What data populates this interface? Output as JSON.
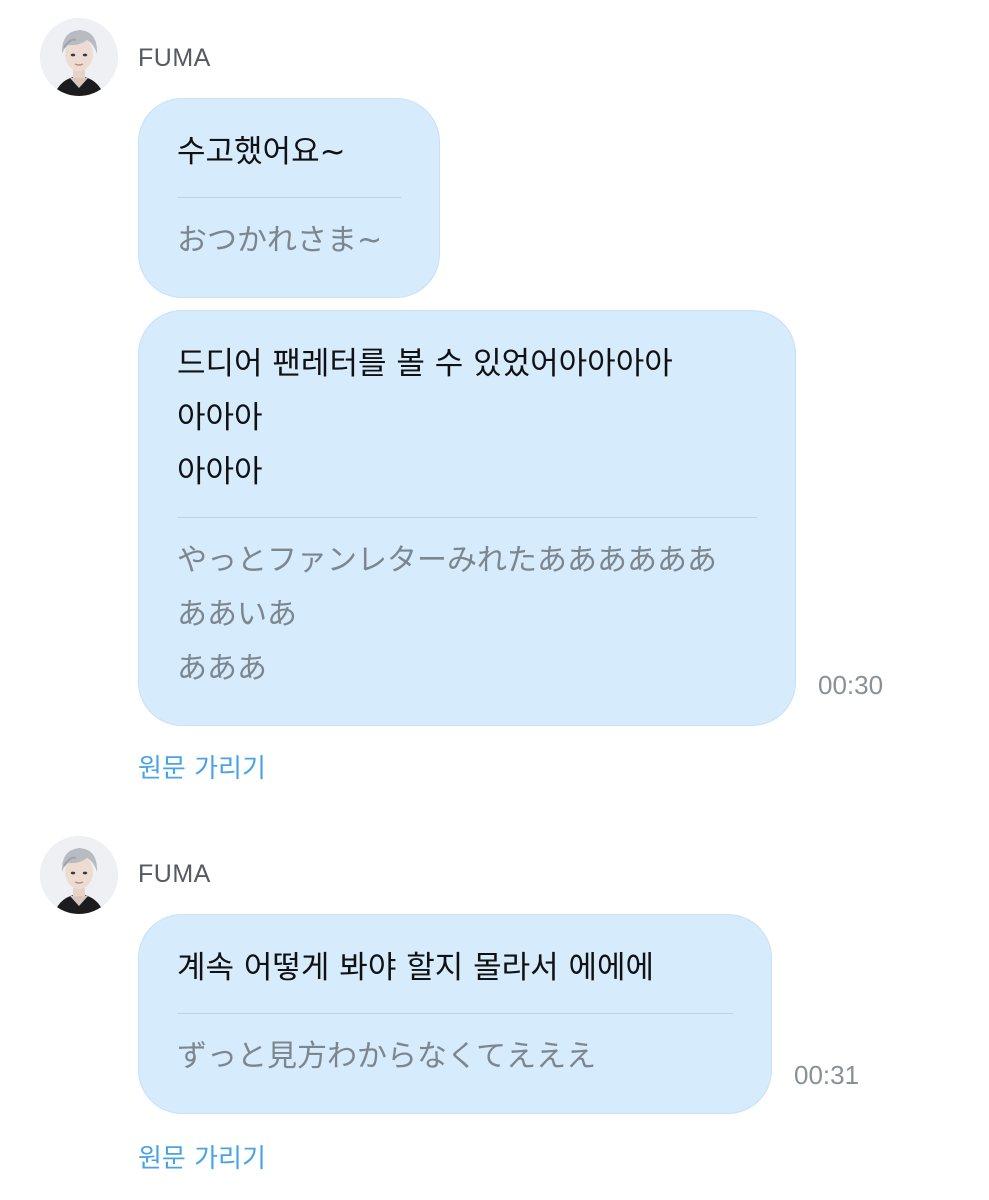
{
  "messages": [
    {
      "sender": "FUMA",
      "bubbles": [
        {
          "original": "수고했어요~",
          "translation": "おつかれさま~",
          "time": ""
        },
        {
          "original": "드디어 팬레터를 볼 수 있었어아아아아\n아아아\n아아아",
          "translation": "やっとファンレターみれたああああああ\nああいあ\nあああ",
          "time": "00:30"
        }
      ],
      "hide_original_label": "원문 가리기"
    },
    {
      "sender": "FUMA",
      "bubbles": [
        {
          "original": "계속 어떻게 봐야 할지 몰라서 에에에",
          "translation": "ずっと見方わからなくてえええ",
          "time": "00:31"
        }
      ],
      "hide_original_label": "원문 가리기"
    }
  ],
  "colors": {
    "bubble_bg": "#d6ebfc",
    "link": "#4aa3e6",
    "translation_text": "#7c868f",
    "timestamp": "#8a9097"
  }
}
